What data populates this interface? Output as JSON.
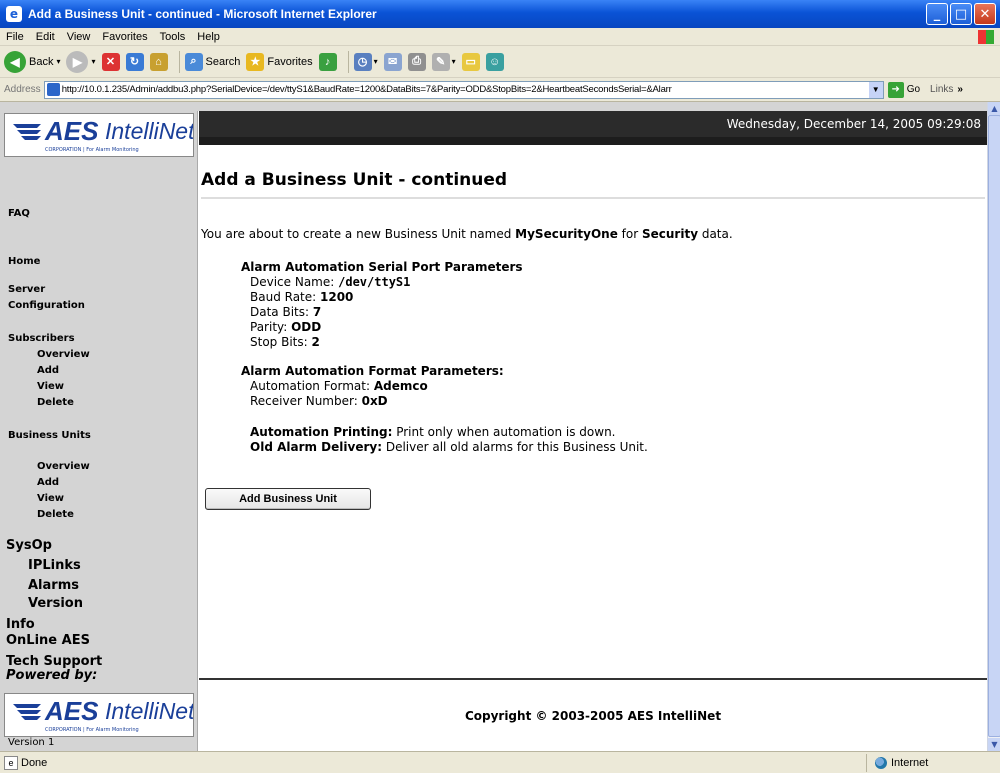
{
  "window": {
    "title": "Add a Business Unit - continued - Microsoft Internet Explorer",
    "minimize": "_",
    "maximize": "□",
    "close": "✕"
  },
  "menu": [
    "File",
    "Edit",
    "View",
    "Favorites",
    "Tools",
    "Help"
  ],
  "toolbar": {
    "back": "Back",
    "search": "Search",
    "favorites": "Favorites"
  },
  "address": {
    "label": "Address",
    "url": "http://10.0.1.235/Admin/addbu3.php?SerialDevice=/dev/ttyS1&BaudRate=1200&DataBits=7&Parity=ODD&StopBits=2&HeartbeatSecondsSerial=&Alarr",
    "go": "Go",
    "links": "Links"
  },
  "header": {
    "date": "Wednesday, December 14, 2005 09:29:08"
  },
  "logo": {
    "aes": "AES",
    "intellinet": "IntelliNet",
    "tagline": "CORPORATION | For Alarm Monitoring"
  },
  "sidebar": {
    "faq": "FAQ",
    "home": "Home",
    "server1": "Server",
    "server2": "Configuration",
    "subscribers": "Subscribers",
    "sub_items": [
      "Overview",
      "Add",
      "View",
      "Delete"
    ],
    "business_units": "Business Units",
    "bu_items": [
      "Overview",
      "Add",
      "View",
      "Delete"
    ],
    "sysop": "SysOp",
    "sysop_items": [
      "IPLinks",
      "Alarms",
      "Version"
    ],
    "info": "Info",
    "online": "OnLine AES",
    "tech": "Tech Support",
    "powered": "Powered by:",
    "version": "Version 1"
  },
  "main": {
    "title": "Add a Business Unit - continued",
    "intro_pre": "You are about to create a new Business Unit named ",
    "bu_name": "MySecurityOne",
    "intro_mid": " for ",
    "data_type": "Security",
    "intro_post": " data.",
    "serial_head": "Alarm Automation Serial Port Parameters",
    "serial": [
      {
        "label": "Device Name: ",
        "value": "/dev/ttyS1"
      },
      {
        "label": "Baud Rate: ",
        "value": "1200"
      },
      {
        "label": "Data Bits: ",
        "value": "7"
      },
      {
        "label": "Parity: ",
        "value": "ODD"
      },
      {
        "label": "Stop Bits: ",
        "value": "2"
      }
    ],
    "format_head": "Alarm Automation Format Parameters:",
    "format": [
      {
        "label": "Automation Format: ",
        "value": "Ademco"
      },
      {
        "label": "Receiver Number: ",
        "value": "0xD"
      }
    ],
    "printing_label": "Automation Printing:",
    "printing_value": " Print only when automation is down.",
    "delivery_label": "Old Alarm Delivery:",
    "delivery_value": " Deliver all old alarms for this Business Unit.",
    "button": "Add Business Unit",
    "copyright": "Copyright © 2003-2005 AES IntelliNet"
  },
  "status": {
    "left": "Done",
    "zone": "Internet"
  }
}
